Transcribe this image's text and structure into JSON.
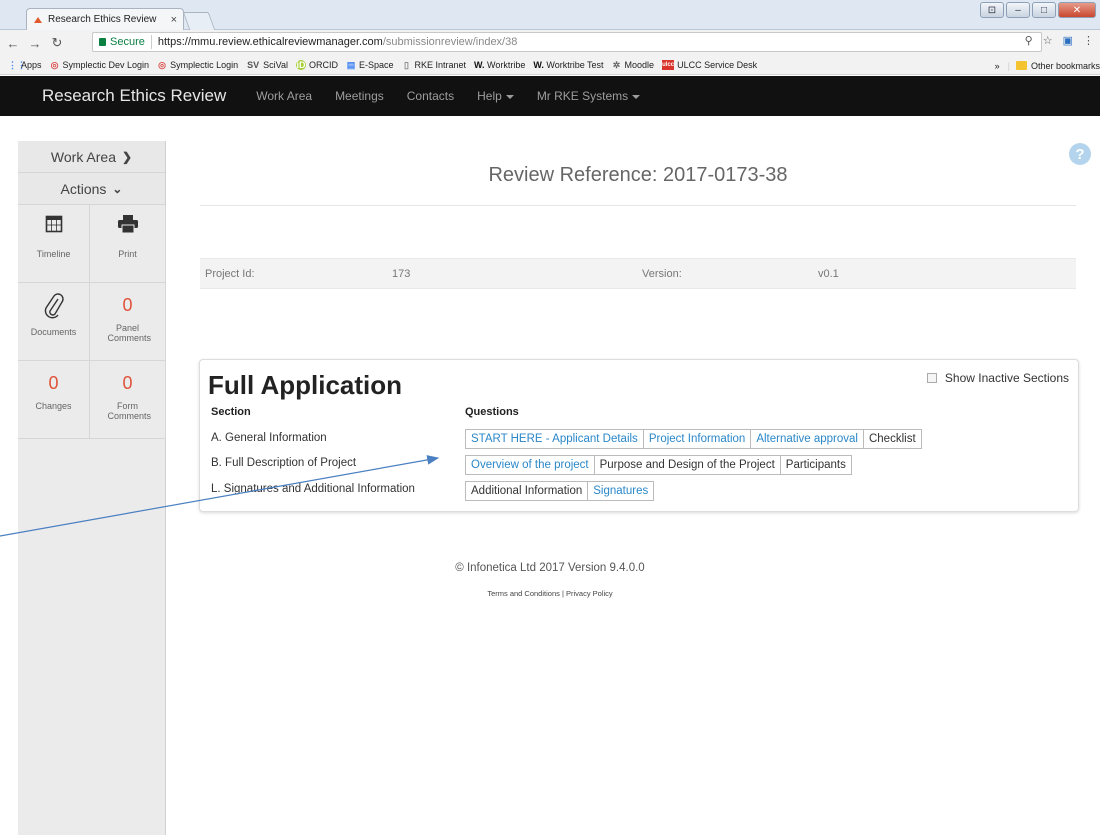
{
  "browser": {
    "tab_title": "Research Ethics Review",
    "tab_close": "×",
    "secure_label": "Secure",
    "url_host": "https://mmu.review.ethicalreviewmanager.com",
    "url_path": "/submissionreview/index/38",
    "bookmarks": [
      {
        "icon": "apps-grid-icon",
        "label": "Apps"
      },
      {
        "icon": "symplectic-icon",
        "label": "Symplectic Dev Login"
      },
      {
        "icon": "symplectic-icon",
        "label": "Symplectic Login"
      },
      {
        "icon": "scival-icon",
        "label": "SciVal"
      },
      {
        "icon": "orcid-icon",
        "label": "ORCID"
      },
      {
        "icon": "page-icon",
        "label": "E-Space"
      },
      {
        "icon": "page-icon",
        "label": "RKE Intranet"
      },
      {
        "icon": "worktribe-icon",
        "label": "Worktribe"
      },
      {
        "icon": "worktribe-icon",
        "label": "Worktribe Test"
      },
      {
        "icon": "moodle-icon",
        "label": "Moodle"
      },
      {
        "icon": "ulcc-icon",
        "label": "ULCC Service Desk"
      }
    ],
    "bookmarks_more": "»",
    "other_bookmarks": "Other bookmarks"
  },
  "navbar": {
    "brand": "Research Ethics Review",
    "links": [
      "Work Area",
      "Meetings",
      "Contacts"
    ],
    "help": "Help",
    "user": "Mr RKE Systems"
  },
  "sidebar": {
    "work_area": "Work Area",
    "actions": "Actions",
    "tiles": {
      "timeline": "Timeline",
      "print": "Print",
      "documents": "Documents",
      "panel_comments_count": "0",
      "panel_comments": "Panel Comments",
      "changes_count": "0",
      "changes": "Changes",
      "form_comments_count": "0",
      "form_comments": "Form Comments"
    }
  },
  "main": {
    "help_icon": "?",
    "review_reference": "Review Reference: 2017-0173-38",
    "project_id_label": "Project Id:",
    "project_id_value": "173",
    "version_label": "Version:",
    "version_value": "v0.1"
  },
  "application": {
    "title": "Full Application",
    "show_inactive": "Show Inactive Sections",
    "section_header": "Section",
    "questions_header": "Questions",
    "sections": [
      {
        "label": "A. General Information",
        "questions": [
          {
            "label": "START HERE - Applicant Details",
            "link": true
          },
          {
            "label": "Project Information",
            "link": true
          },
          {
            "label": "Alternative approval",
            "link": true
          },
          {
            "label": "Checklist",
            "link": false
          }
        ]
      },
      {
        "label": "B. Full Description of Project",
        "questions": [
          {
            "label": "Overview of the project",
            "link": true
          },
          {
            "label": "Purpose and Design of the Project",
            "link": false
          },
          {
            "label": "Participants",
            "link": false
          }
        ]
      },
      {
        "label": "L. Signatures and Additional Information",
        "questions": [
          {
            "label": "Additional Information",
            "link": false
          },
          {
            "label": "Signatures",
            "link": true
          }
        ]
      }
    ]
  },
  "footer": {
    "copyright": "© Infonetica Ltd 2017 Version 9.4.0.0",
    "links": "Terms and Conditions | Privacy Policy"
  },
  "colors": {
    "navbar_bg": "#111111",
    "link": "#2a87c8",
    "count": "#e0533b",
    "annotation_arrow": "#4a7fc1"
  }
}
